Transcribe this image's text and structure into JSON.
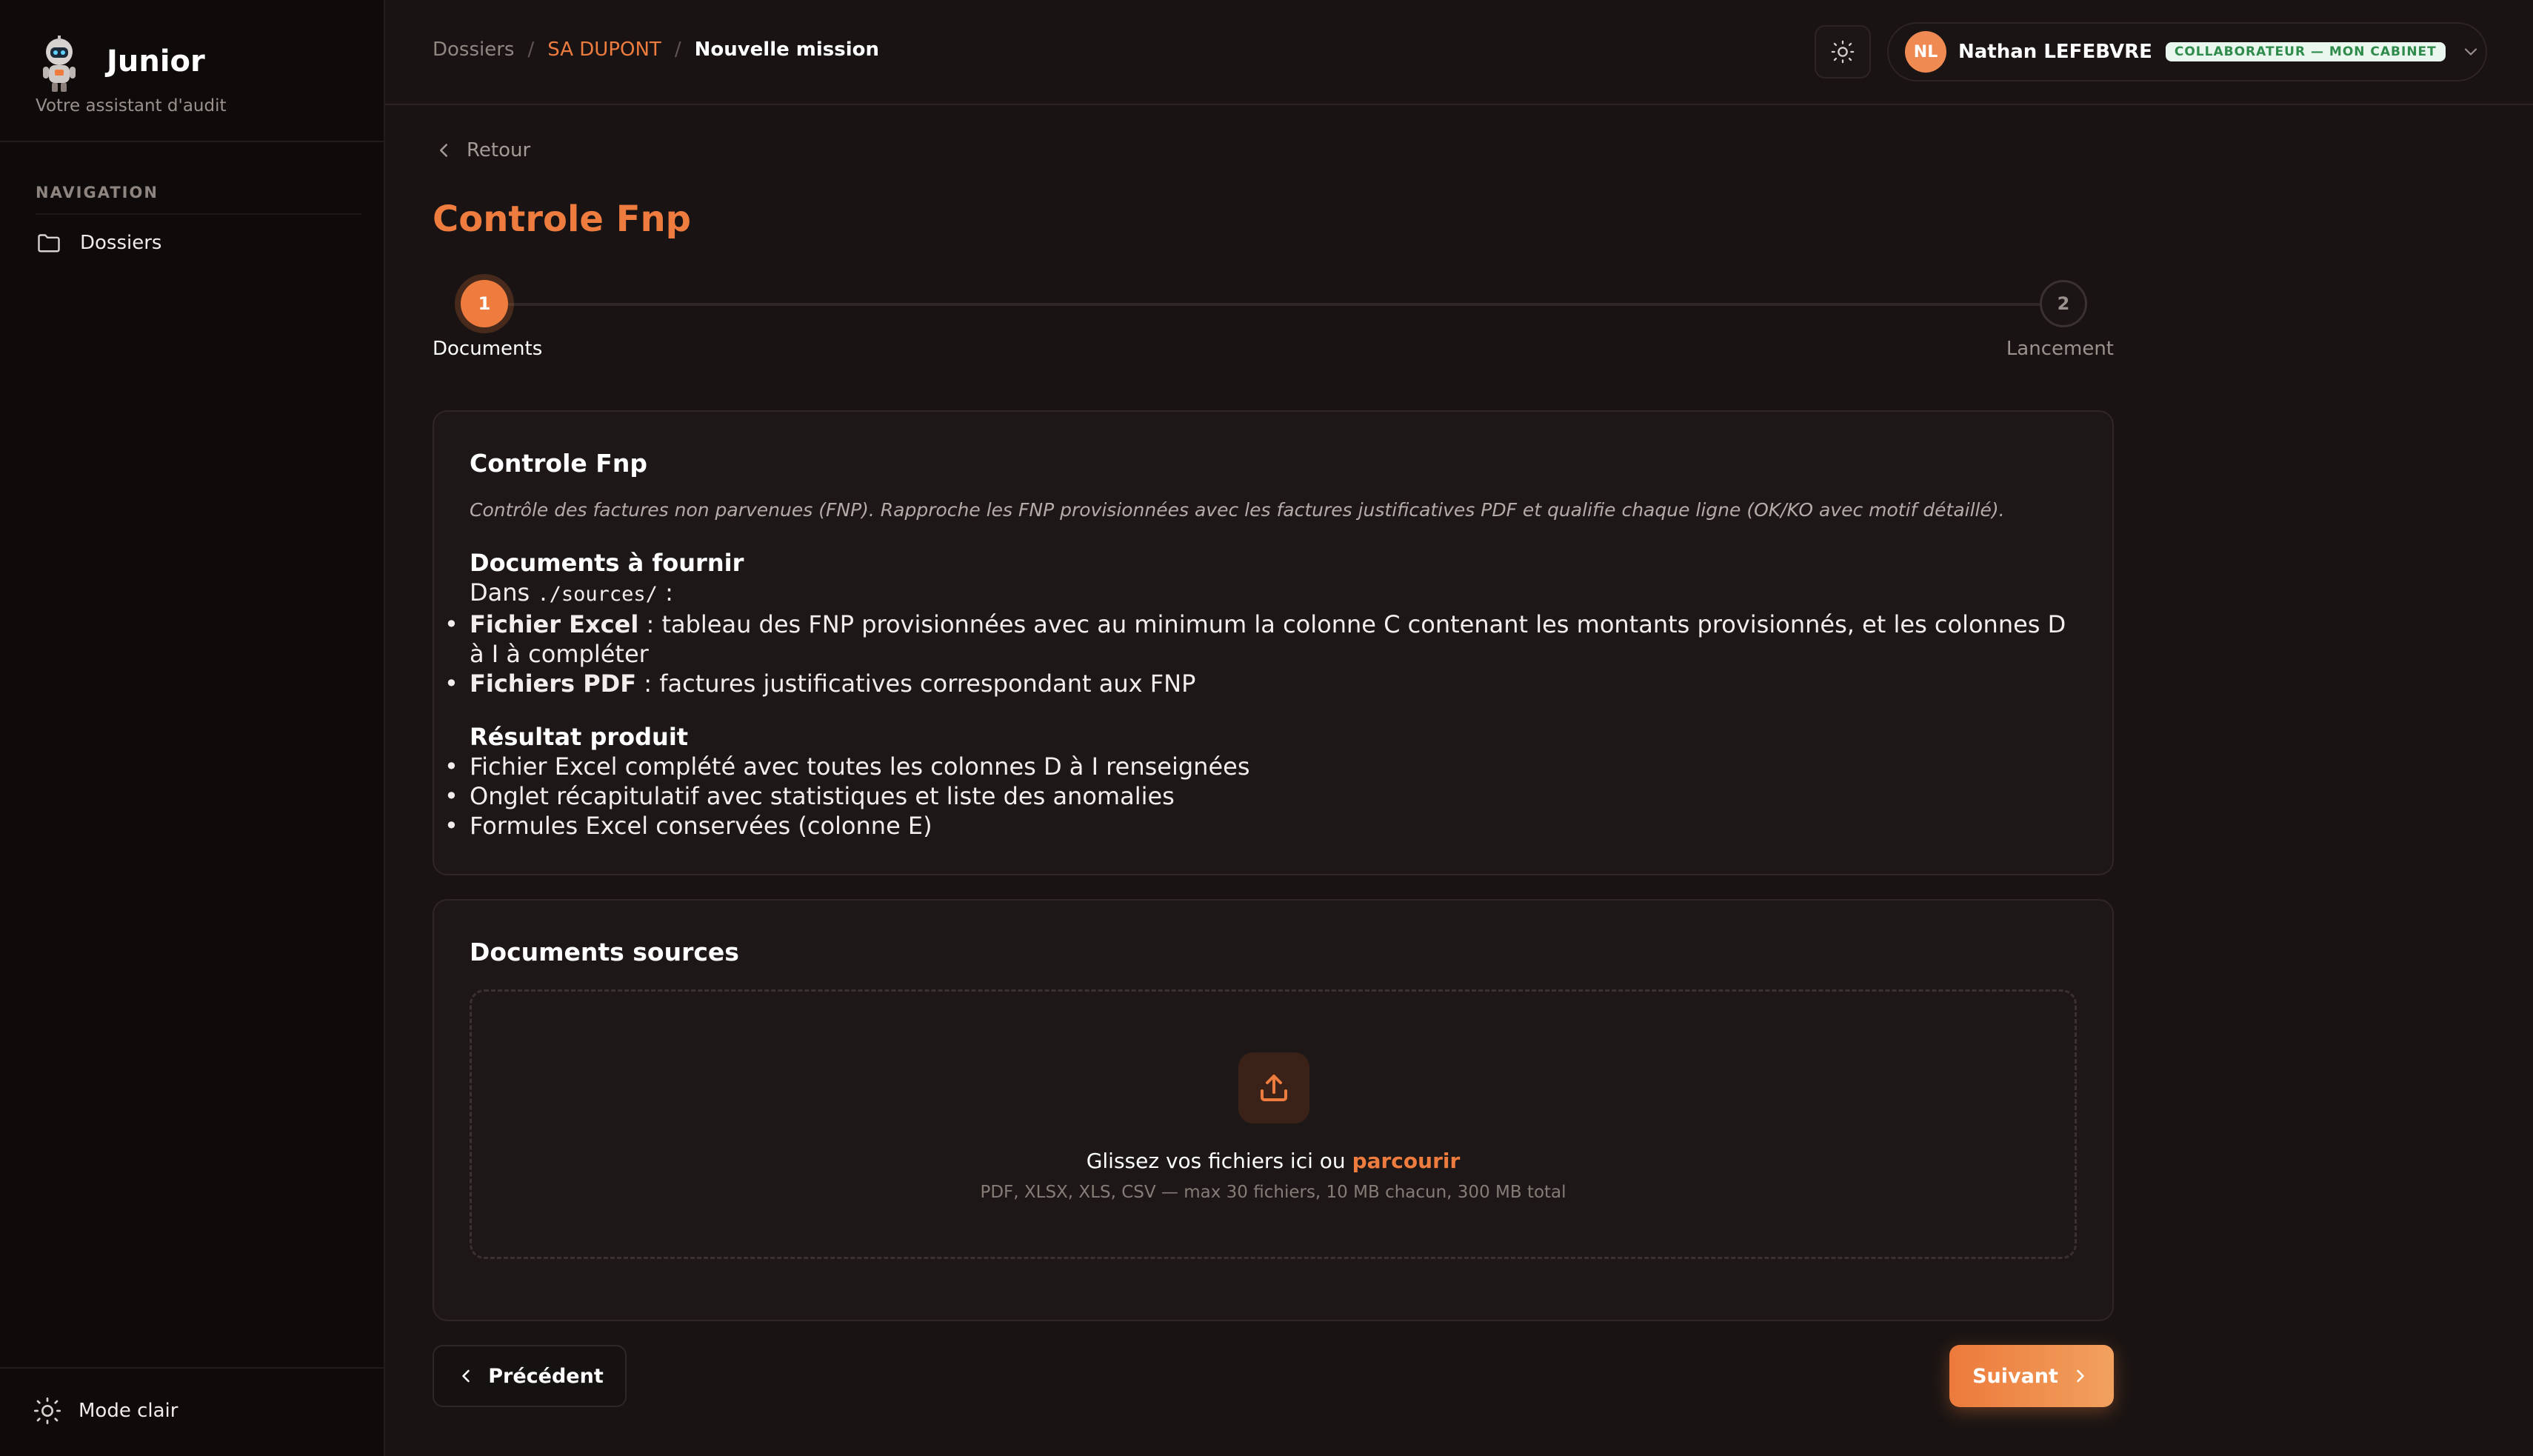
{
  "app": {
    "name": "Junior",
    "tagline": "Votre assistant d'audit"
  },
  "sidebar": {
    "section_title": "NAVIGATION",
    "items": [
      {
        "label": "Dossiers",
        "icon": "folder-icon"
      }
    ],
    "mode_toggle": {
      "label": "Mode clair",
      "icon": "sun-icon"
    }
  },
  "header": {
    "breadcrumb": [
      "Dossiers",
      "SA DUPONT",
      "Nouvelle mission"
    ],
    "theme_icon": "sun-icon",
    "user": {
      "initials": "NL",
      "name": "Nathan LEFEBVRE",
      "role_badge": "COLLABORATEUR — MON CABINET"
    }
  },
  "main": {
    "back_label": "Retour",
    "title": "Controle Fnp",
    "stepper": [
      {
        "number": "1",
        "label": "Documents",
        "state": "active"
      },
      {
        "number": "2",
        "label": "Lancement",
        "state": "pending"
      }
    ],
    "description_card": {
      "title": "Controle Fnp",
      "summary": "Contrôle des factures non parvenues (FNP). Rapproche les FNP provisionnées avec les factures justificatives PDF et qualifie chaque ligne (OK/KO avec motif détaillé).",
      "docs_heading": "Documents à fournir",
      "docs_location_prefix": "Dans ",
      "docs_location_path": "./sources/",
      "docs_location_suffix": " :",
      "docs_items": [
        {
          "bold": "Fichier Excel",
          "text": " : tableau des FNP provisionnées avec au minimum la colonne C contenant les montants provisionnés, et les colonnes D à I à compléter"
        },
        {
          "bold": "Fichiers PDF",
          "text": " : factures justificatives correspondant aux FNP"
        }
      ],
      "result_heading": "Résultat produit",
      "result_items": [
        "Fichier Excel complété avec toutes les colonnes D à I renseignées",
        "Onglet récapitulatif avec statistiques et liste des anomalies",
        "Formules Excel conservées (colonne E)"
      ]
    },
    "sources_card": {
      "title": "Documents sources",
      "drop_text": "Glissez vos fichiers ici ou ",
      "browse_label": "parcourir",
      "hint": "PDF, XLSX, XLS, CSV — max 30 fichiers, 10 MB chacun, 300 MB total"
    },
    "buttons": {
      "previous": "Précédent",
      "next": "Suivant"
    }
  },
  "colors": {
    "accent": "#ee7c3f",
    "background": "#191413",
    "sidebar": "#0f0b0a",
    "badge_bg": "#eaf7ee",
    "badge_text": "#2f8b4c"
  }
}
